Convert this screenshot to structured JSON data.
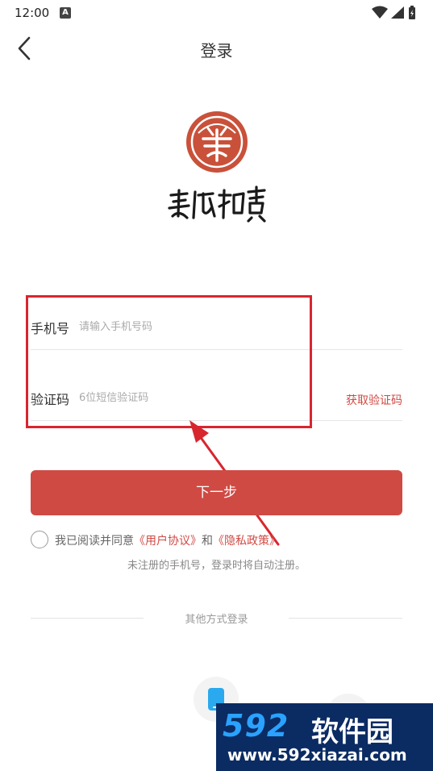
{
  "status_bar": {
    "time": "12:00",
    "notification_badge": "A",
    "icons": [
      "wifi-icon",
      "signal-icon",
      "battery-icon"
    ]
  },
  "header": {
    "title": "登录",
    "back_icon": "chevron-left-icon"
  },
  "logo": {
    "brand_text": "美術拍賣"
  },
  "form": {
    "phone_label": "手机号",
    "phone_placeholder": "请输入手机号码",
    "phone_value": "",
    "code_label": "验证码",
    "code_placeholder": "6位短信验证码",
    "code_value": "",
    "get_code_label": "获取验证码"
  },
  "next_button": "下一步",
  "agreement": {
    "checked": false,
    "prefix": "我已阅读并同意",
    "user_agreement": "《用户协议》",
    "and": "和",
    "privacy_policy": "《隐私政策》"
  },
  "notice": "未注册的手机号，登录时将自动注册。",
  "other_login": {
    "label": "其他方式登录",
    "methods": [
      "phone-icon",
      "wechat-icon"
    ]
  },
  "watermark": {
    "logo": "592",
    "name": "软件园",
    "url": "www.592xiazai.com"
  },
  "colors": {
    "accent": "#d04a44",
    "highlight": "#d8262f",
    "seal": "#c9513a",
    "phone_icon": "#2aa9ee",
    "watermark_bg": "#0b2b63"
  }
}
